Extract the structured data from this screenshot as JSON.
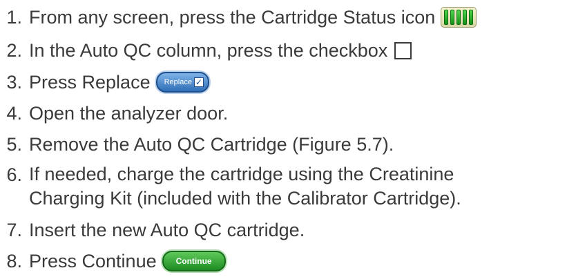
{
  "steps": [
    {
      "num": "1.",
      "text": "From any screen, press the Cartridge Status icon",
      "icon": "cartridge-status-icon"
    },
    {
      "num": "2.",
      "text": "In the Auto QC column, press the checkbox",
      "icon": "checkbox-icon"
    },
    {
      "num": "3.",
      "text": "Press Replace",
      "button_label": "Replace"
    },
    {
      "num": "4.",
      "text": "Open the analyzer door."
    },
    {
      "num": "5.",
      "text": "Remove the Auto QC Cartridge (Figure 5.7)."
    },
    {
      "num": "6.",
      "text": "If needed, charge the cartridge using the Creatinine Charging Kit (included with the Calibrator Cartridge)."
    },
    {
      "num": "7.",
      "text": "Insert the new Auto QC cartridge."
    },
    {
      "num": "8.",
      "text": "Press Continue",
      "button_label": "Continue"
    }
  ],
  "colors": {
    "text": "#3a3a3a",
    "replace_button": "#2f6fb7",
    "continue_button": "#1d8c22",
    "cartridge_bars": "#14901a"
  }
}
